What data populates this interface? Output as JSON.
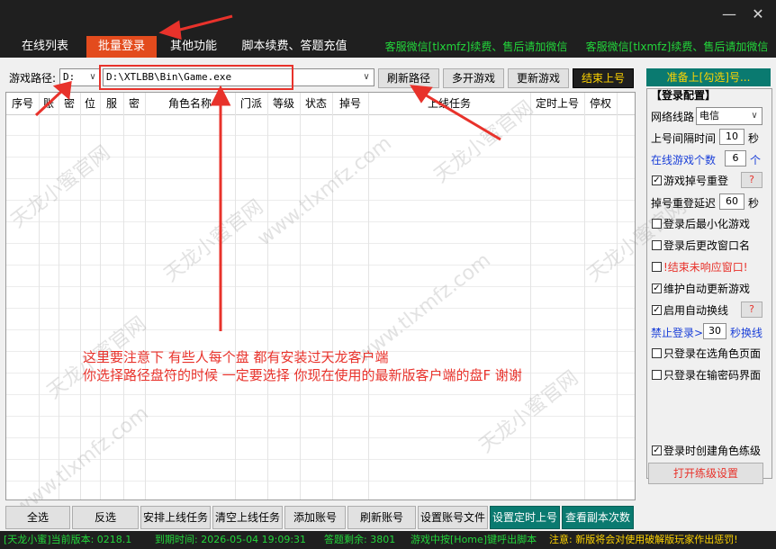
{
  "window": {
    "minimize_icon": "minimize-icon",
    "close_icon": "close-icon"
  },
  "tabs": [
    {
      "label": "在线列表"
    },
    {
      "label": "批量登录"
    },
    {
      "label": "其他功能"
    },
    {
      "label": "脚本续费、答题充值"
    },
    {
      "label": "客服微信[tlxmfz]续费、售后请加微信"
    },
    {
      "label": "客服微信[tlxmfz]续费、售后请加微信"
    }
  ],
  "path_row": {
    "label": "游戏路径:",
    "drive": "D:",
    "path": "D:\\XTLBB\\Bin\\Game.exe",
    "refresh_btn": "刷新路径",
    "multi_btn": "多开游戏",
    "update_btn": "更新游戏",
    "end_btn": "结束上号"
  },
  "table": {
    "columns": [
      "序号",
      "账",
      "密",
      "位",
      "服",
      "密",
      "角色名称",
      "门派",
      "等级",
      "状态",
      "掉号",
      "上线任务",
      "定时上号",
      "停权"
    ],
    "rows": []
  },
  "note": {
    "line1": "这里要注意下 有些人每个盘 都有安装过天龙客户端",
    "line2": "你选择路径盘符的时候 一定要选择 你现在使用的最新版客户端的盘F 谢谢"
  },
  "watermark": {
    "text_a": "天龙小蜜官网",
    "text_b": "www.tlxmfz.com"
  },
  "right_panel": {
    "ready_label": "准备上[勾选]号...",
    "group_title": "【登录配置】",
    "network_label": "网络线路",
    "network_value": "电信",
    "interval_label": "上号间隔时间",
    "interval_value": "10",
    "interval_unit": "秒",
    "online_label": "在线游戏个数",
    "online_value": "6",
    "online_unit": "个",
    "drop_relogin": "游戏掉号重登",
    "drop_delay_label": "掉号重登延迟",
    "drop_delay_value": "60",
    "drop_delay_unit": "秒",
    "minimize_after": "登录后最小化游戏",
    "rename_after": "登录后更改窗口名",
    "end_unresponsive": "!结束未响应窗口!",
    "auto_update": "维护自动更新游戏",
    "auto_switch": "启用自动换线",
    "ban_login_label": "禁止登录>",
    "ban_login_value": "30",
    "ban_login_unit": "秒换线",
    "only_char_page": "只登录在选角色页面",
    "only_pwd_page": "只登录在输密码界面",
    "create_char": "登录时创建角色练级",
    "open_level_btn": "打开练级设置",
    "question_mark": "?",
    "checks": {
      "drop_relogin": true,
      "minimize_after": false,
      "rename_after": false,
      "end_unresponsive": false,
      "auto_update": true,
      "auto_switch": true,
      "only_char_page": false,
      "only_pwd_page": false,
      "create_char": true
    }
  },
  "bottom_buttons": [
    "全选",
    "反选",
    "安排上线任务",
    "清空上线任务",
    "添加账号",
    "刷新账号",
    "设置账号文件",
    "设置定时上号",
    "查看副本次数"
  ],
  "status_bar": {
    "version": "[天龙小蜜]当前版本: 0218.1",
    "expire": "到期时间: 2026-05-04 19:09:31",
    "answers": "答题剩余: 3801",
    "hotkey": "游戏中按[Home]键呼出脚本",
    "notice": "注意: 新版将会对使用破解版玩家作出惩罚!"
  },
  "colors": {
    "accent_tab": "#e34b1d",
    "annotation_red": "#e8322b",
    "status_green": "#22d63a",
    "teal": "#0a7a70"
  }
}
